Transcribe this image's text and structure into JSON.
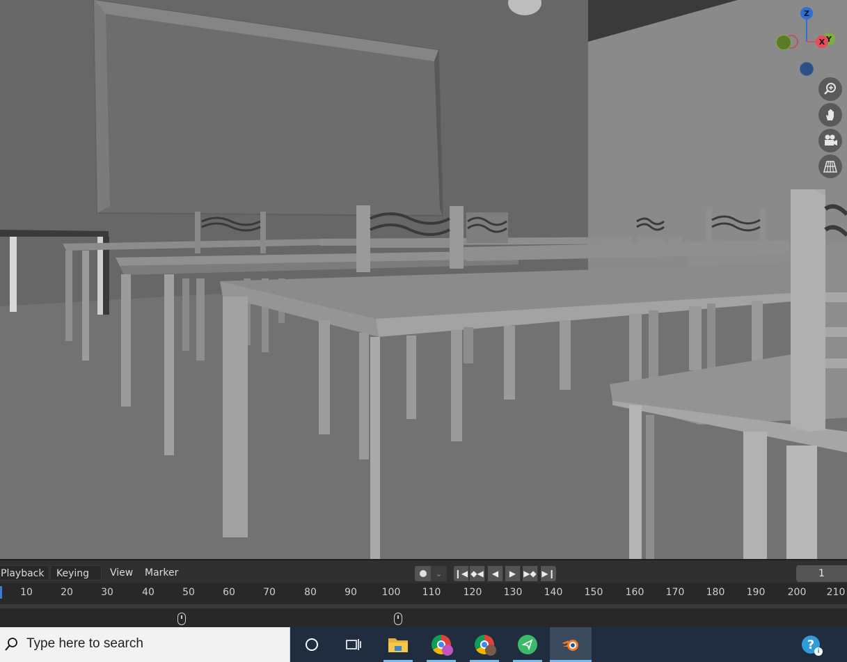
{
  "viewport": {
    "gizmo": {
      "axes": [
        {
          "label": "Z",
          "color": "#2f6fd8"
        },
        {
          "label": "X",
          "color": "#e84b5a"
        },
        {
          "label": "Y",
          "color": "#7fae3a"
        }
      ]
    },
    "nav_buttons": [
      {
        "name": "zoom",
        "icon": "zoom-icon"
      },
      {
        "name": "pan",
        "icon": "hand-icon"
      },
      {
        "name": "camera",
        "icon": "camera-icon"
      },
      {
        "name": "perspective",
        "icon": "grid-perspective-icon"
      }
    ]
  },
  "timeline": {
    "menus": {
      "playback": "Playback",
      "keying": "Keying",
      "view": "View",
      "marker": "Marker"
    },
    "current_frame": "1",
    "ruler_ticks": [
      "10",
      "20",
      "30",
      "40",
      "50",
      "60",
      "70",
      "80",
      "90",
      "100",
      "110",
      "120",
      "130",
      "140",
      "150",
      "160",
      "170",
      "180",
      "190",
      "200",
      "210"
    ]
  },
  "taskbar": {
    "search_placeholder": "Type here to search",
    "apps": [
      {
        "name": "cortana",
        "icon": "cortana-icon"
      },
      {
        "name": "task-view",
        "icon": "task-view-icon"
      },
      {
        "name": "file-explorer",
        "icon": "folder-icon"
      },
      {
        "name": "chrome-profile-1",
        "icon": "chrome-icon"
      },
      {
        "name": "chrome-profile-2",
        "icon": "chrome-icon"
      },
      {
        "name": "app-green",
        "icon": "send-icon"
      },
      {
        "name": "blender",
        "icon": "blender-icon"
      }
    ],
    "help_icon": "help-icon"
  }
}
